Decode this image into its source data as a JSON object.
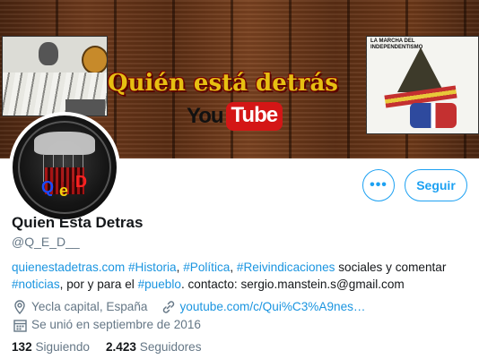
{
  "banner": {
    "title": "Quién está detrás",
    "yt_you": "You",
    "yt_tube": "Tube",
    "right_panel_caption": "LA MARCHA DEL INDEPENDENTISMO"
  },
  "actions": {
    "more_label": "•••",
    "follow_label": "Seguir"
  },
  "profile": {
    "name": "Quien Esta Detras",
    "handle": "@Q_E_D__",
    "bio": {
      "link1": "quienestadetras.com",
      "tag_historia": "#Historia",
      "sep1": ", ",
      "tag_politica": "#Política",
      "sep2": ", ",
      "tag_reivindicaciones": "#Reivindicaciones",
      "text1": " sociales y comentar",
      "tag_noticias": "#noticias",
      "text2": ", por y para el ",
      "tag_pueblo": "#pueblo",
      "text3": ". contacto:  sergio.manstein.s@gmail.com"
    },
    "location": "Yecla capital, España",
    "website": "youtube.com/c/Qui%C3%A9nes…",
    "joined": "Se unió en septiembre de 2016",
    "following_count": "132",
    "following_label": "Siguiendo",
    "followers_count": "2.423",
    "followers_label": "Seguidores"
  },
  "colors": {
    "accent": "#1da1f2",
    "link": "#1b95e0",
    "muted": "#657786",
    "text": "#14171a"
  }
}
